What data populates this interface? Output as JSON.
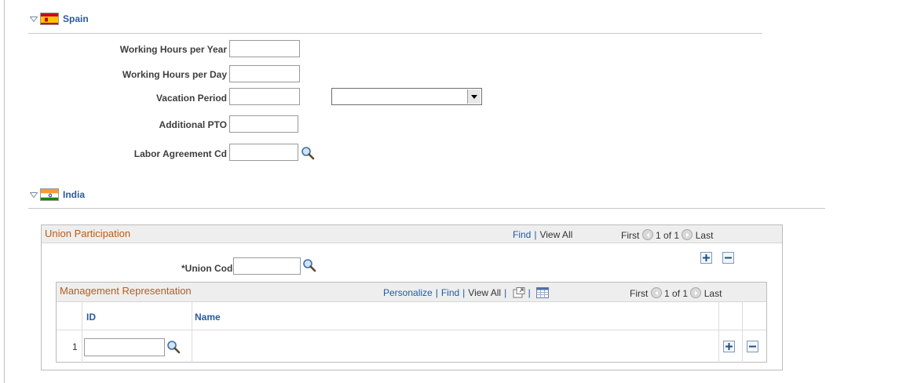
{
  "spain": {
    "title": "Spain",
    "fields": {
      "working_hours_year_label": "Working Hours per Year",
      "working_hours_year_value": "",
      "working_hours_day_label": "Working Hours per Day",
      "working_hours_day_value": "",
      "vacation_period_label": "Vacation Period",
      "vacation_period_value": "",
      "vacation_period_unit_selected": "",
      "additional_pto_label": "Additional PTO",
      "additional_pto_value": "",
      "labor_agreement_label": "Labor Agreement Cd",
      "labor_agreement_value": ""
    }
  },
  "india": {
    "title": "India",
    "union_participation": {
      "title": "Union Participation",
      "find": "Find",
      "view_all": "View All",
      "first": "First",
      "count": "1 of 1",
      "last": "Last",
      "union_code_label": "*Union Code",
      "union_code_value": ""
    },
    "management_representation": {
      "title": "Management Representation",
      "personalize": "Personalize",
      "find": "Find",
      "view_all": "View All",
      "first": "First",
      "count": "1 of 1",
      "last": "Last",
      "columns": [
        "ID",
        "Name"
      ],
      "rows": [
        {
          "num": "1",
          "id": "",
          "name": ""
        }
      ]
    }
  },
  "icons": {
    "collapse": "chevron-down-icon",
    "lookup": "magnifier-icon",
    "zoom": "new-window-icon",
    "download": "spreadsheet-icon",
    "add": "plus-icon",
    "delete": "minus-icon",
    "prev": "arrow-left-icon",
    "next": "arrow-right-icon"
  },
  "colors": {
    "link": "#1f5aa6",
    "section_title": "#2a5b9c",
    "box_title": "#b85c1a"
  }
}
